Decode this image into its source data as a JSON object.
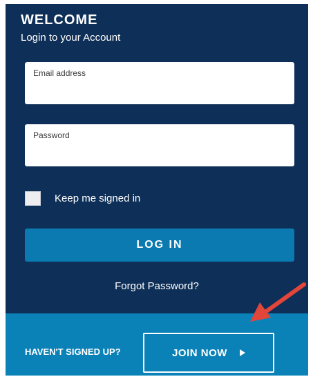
{
  "header": {
    "title": "WELCOME",
    "subtitle": "Login to your Account"
  },
  "form": {
    "email_placeholder": "Email address",
    "password_placeholder": "Password",
    "remember_label": "Keep me signed in",
    "login_label": "LOG IN",
    "forgot_label": "Forgot Password?"
  },
  "footer": {
    "prompt": "HAVEN'T SIGNED UP?",
    "join_label": "JOIN NOW"
  },
  "colors": {
    "panel_bg": "#0e2f57",
    "button_blue": "#0a7ab0",
    "footer_bg": "#0a82b8",
    "annotation_arrow": "#e2453a"
  },
  "icons": {
    "join_icon": "play-icon",
    "annotation": "red-arrow-icon"
  }
}
